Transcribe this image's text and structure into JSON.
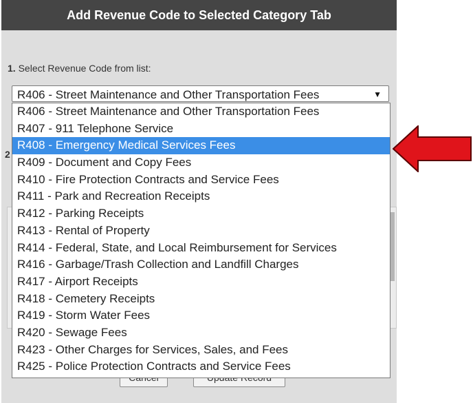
{
  "dialog": {
    "title": "Add Revenue Code to Selected Category Tab",
    "step1_number": "1.",
    "step1_label": "Select Revenue Code from list:",
    "step2_hint": "2",
    "cancel_label": "Cancel",
    "update_label": "Update Record"
  },
  "select": {
    "value": "R406 - Street Maintenance and Other Transportation Fees",
    "caret": "▼"
  },
  "dropdown": {
    "selected_index": 2,
    "options": [
      "R406 - Street Maintenance and Other Transportation Fees",
      "R407 - 911 Telephone Service",
      "R408 - Emergency Medical Services Fees",
      "R409 - Document and Copy Fees",
      "R410 - Fire Protection Contracts and Service Fees",
      "R411 - Park and Recreation Receipts",
      "R412 - Parking Receipts",
      "R413 - Rental of Property",
      "R414 - Federal, State, and Local Reimbursement for Services",
      "R416 - Garbage/Trash Collection and Landfill Charges",
      "R417 - Airport Receipts",
      "R418 - Cemetery Receipts",
      "R419 - Storm Water Fees",
      "R420 - Sewage Fees",
      "R423 - Other Charges for Services, Sales, and Fees",
      "R425 - Police Protection Contracts and Service Fees"
    ]
  },
  "colors": {
    "title_bar": "#454545",
    "dialog_bg": "#dedede",
    "highlight": "#3b8ee6",
    "arrow": "#e0141b"
  },
  "annotation": {
    "icon": "red-arrow-icon"
  }
}
